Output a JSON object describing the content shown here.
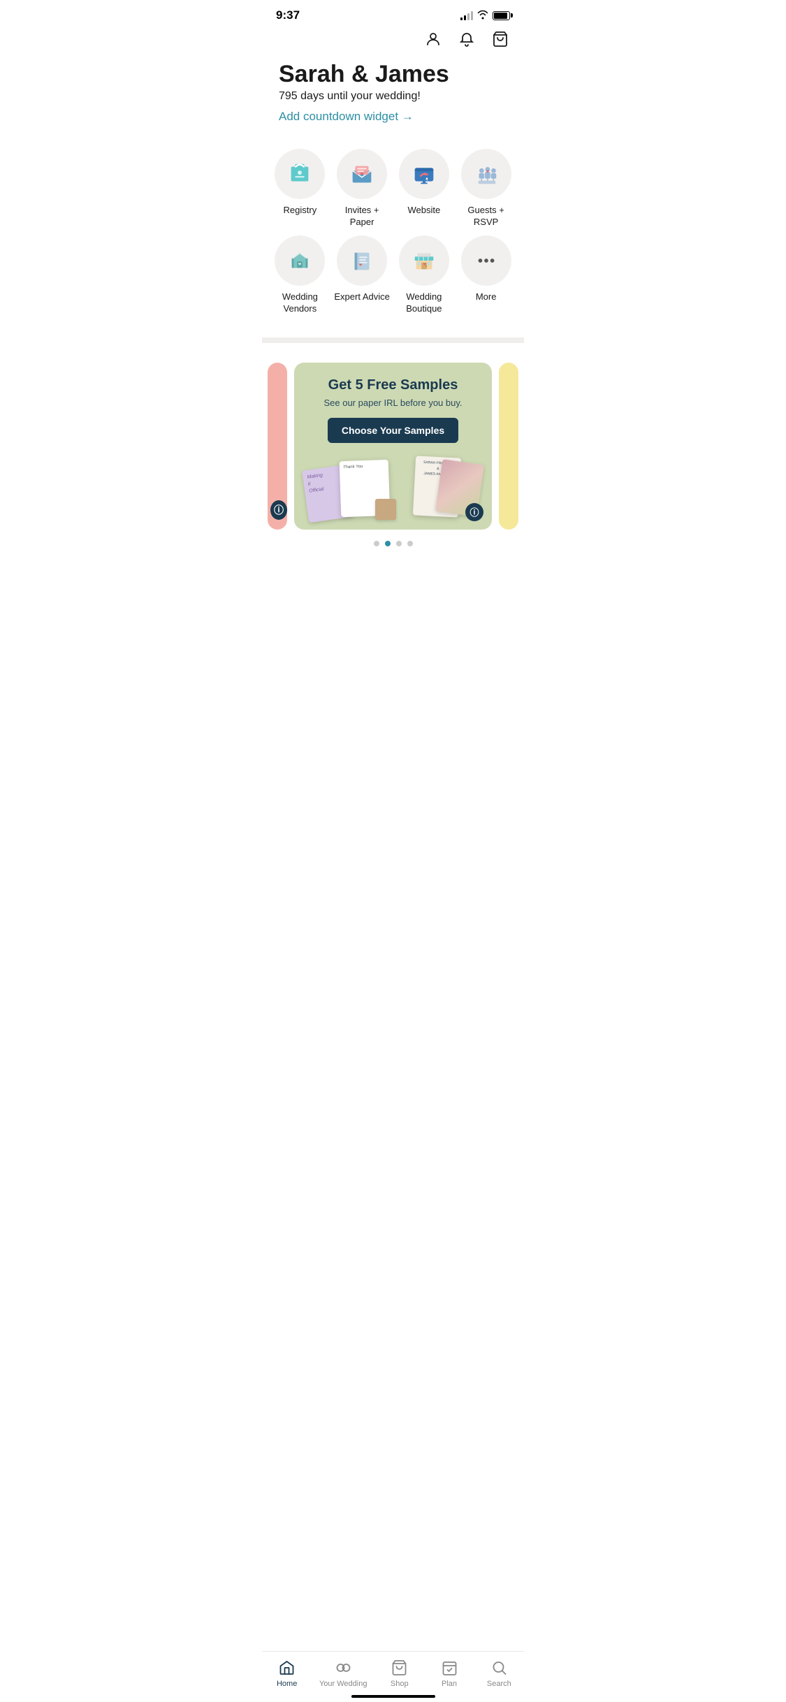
{
  "status": {
    "time": "9:37"
  },
  "header": {
    "title": "Sarah & James",
    "subtitle": "795 days until your wedding!",
    "countdown_link": "Add countdown widget →"
  },
  "grid_row1": [
    {
      "id": "registry",
      "label": "Registry"
    },
    {
      "id": "invites",
      "label": "Invites + Paper"
    },
    {
      "id": "website",
      "label": "Website"
    },
    {
      "id": "guests",
      "label": "Guests + RSVP"
    }
  ],
  "grid_row2": [
    {
      "id": "vendors",
      "label": "Wedding Vendors"
    },
    {
      "id": "advice",
      "label": "Expert Advice"
    },
    {
      "id": "boutique",
      "label": "Wedding Boutique"
    },
    {
      "id": "more",
      "label": "More"
    }
  ],
  "promo_card": {
    "title": "Get 5 Free Samples",
    "subtitle": "See our paper IRL before you buy.",
    "button": "Choose Your Samples"
  },
  "carousel_dots": [
    {
      "active": false
    },
    {
      "active": true
    },
    {
      "active": false
    },
    {
      "active": false
    }
  ],
  "bottom_nav": [
    {
      "id": "home",
      "label": "Home",
      "active": true
    },
    {
      "id": "your-wedding",
      "label": "Your Wedding",
      "active": false
    },
    {
      "id": "shop",
      "label": "Shop",
      "active": false
    },
    {
      "id": "plan",
      "label": "Plan",
      "active": false
    },
    {
      "id": "search",
      "label": "Search",
      "active": false
    }
  ]
}
